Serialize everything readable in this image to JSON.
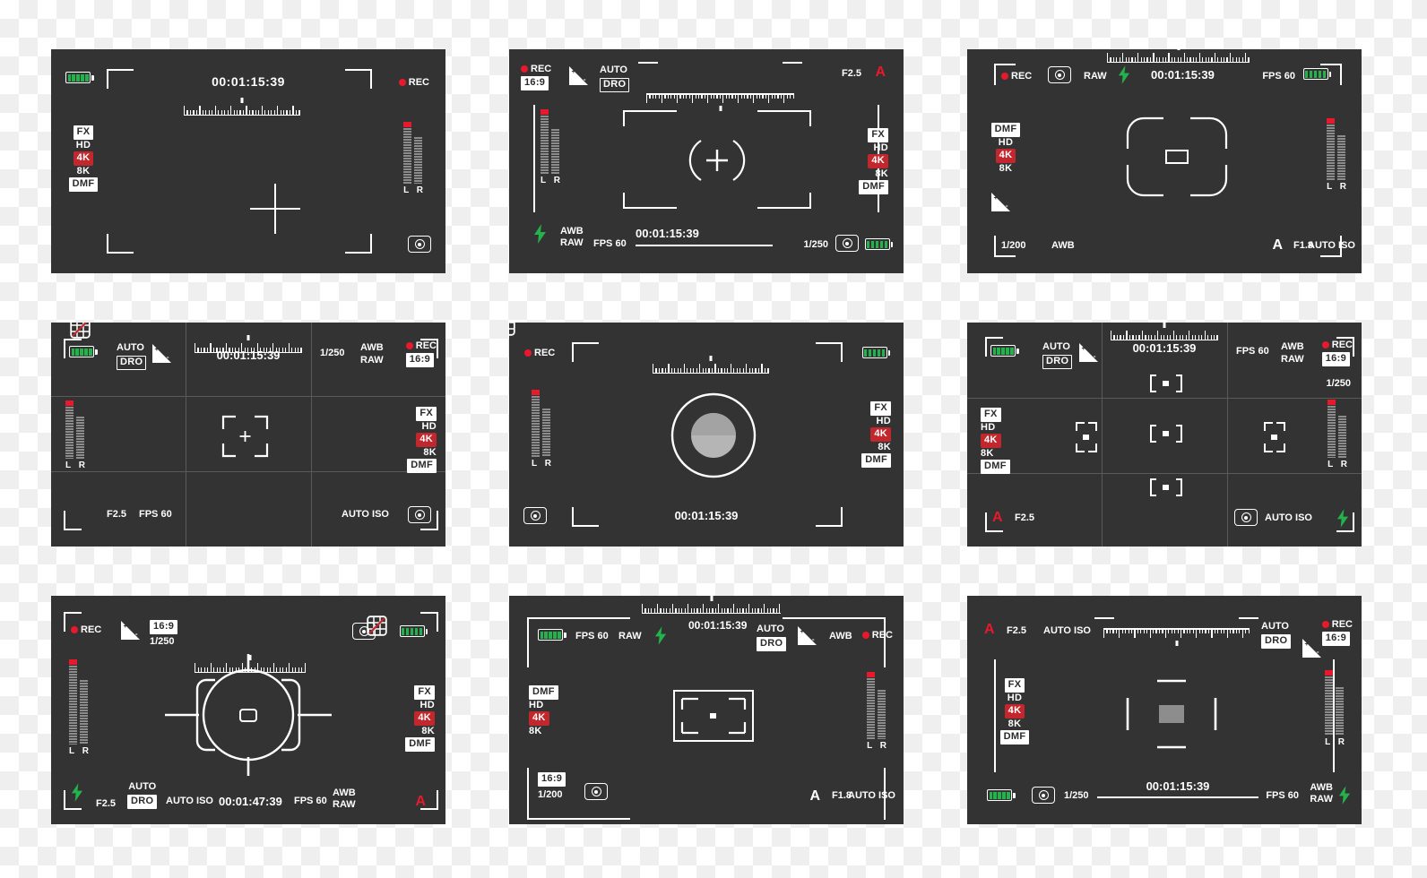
{
  "common": {
    "timecode": "00:01:15:39",
    "rec": "REC",
    "ratio_169": "16:9",
    "auto": "AUTO",
    "dro": "DRO",
    "raw": "RAW",
    "awb": "AWB",
    "fps60": "FPS 60",
    "fx": "FX",
    "hd": "HD",
    "k4": "4K",
    "k8": "8K",
    "dmf": "DMF",
    "auto_iso": "AUTO ISO",
    "audio_l": "L",
    "audio_r": "R",
    "audio_lr": "L R",
    "a_mode": "A",
    "f25": "F2.5",
    "f18": "F1.8",
    "ss_250": "1/250",
    "ss_200": "1/200"
  },
  "colors": {
    "panel_bg": "#333333",
    "rec_red": "#e8192c",
    "badge_red": "#c1272d",
    "battery_green": "#23b24b",
    "flash_green": "#23b24b",
    "white": "#ffffff",
    "divider": "#5a5a5a",
    "meter_gray": "#8c8c8c",
    "fill_gray": "#9a9a9a"
  },
  "panels": [
    {
      "id": "viewfinder-1",
      "layout": "crosshair-corners",
      "battery": "battery-icon",
      "timecode": "00:01:15:39",
      "rec": "REC",
      "resolutions": [
        "FX",
        "HD",
        "4K",
        "8K",
        "DMF"
      ],
      "selected_resolution": "4K",
      "grid_icon": "grid-off-icon",
      "metering_icon": "metering-icon",
      "audio_label": "L R"
    },
    {
      "id": "viewfinder-2",
      "layout": "center-bracket-plus",
      "rec": "REC",
      "ratio": "16:9",
      "ev_icon": "exposure-compensation-icon",
      "auto": "AUTO",
      "dro": "DRO",
      "aperture": "F2.5",
      "mode": "A",
      "flash_icon": "flash-icon",
      "awb": "AWB",
      "raw": "RAW",
      "fps": "FPS 60",
      "timecode": "00:01:15:39",
      "shutter": "1/250",
      "metering_icon": "metering-icon",
      "battery": "battery-icon",
      "resolutions": [
        "FX",
        "HD",
        "4K",
        "8K",
        "DMF"
      ],
      "selected_resolution": "4K",
      "audio_label": "L R"
    },
    {
      "id": "viewfinder-3",
      "layout": "rounded-focus-box",
      "rec": "REC",
      "metering_icon": "metering-icon",
      "raw": "RAW",
      "flash_icon": "flash-icon",
      "timecode": "00:01:15:39",
      "fps": "FPS 60",
      "battery": "battery-icon",
      "resolutions": [
        "DMF",
        "HD",
        "4K",
        "8K"
      ],
      "selected_resolution": "4K",
      "ev_icon": "exposure-compensation-icon",
      "shutter": "1/200",
      "awb": "AWB",
      "mode": "A",
      "aperture": "F1.8",
      "iso": "AUTO ISO",
      "audio_label": "L R"
    },
    {
      "id": "viewfinder-4",
      "layout": "thirds-grid",
      "battery": "battery-icon",
      "auto": "AUTO",
      "dro": "DRO",
      "ev_icon": "exposure-compensation-icon",
      "timecode": "00:01:15:39",
      "shutter": "1/250",
      "awb": "AWB",
      "raw": "RAW",
      "rec": "REC",
      "ratio": "16:9",
      "resolutions": [
        "FX",
        "HD",
        "4K",
        "8K",
        "DMF"
      ],
      "selected_resolution": "4K",
      "grid_icon": "grid-off-icon",
      "aperture": "F2.5",
      "fps": "FPS 60",
      "iso": "AUTO ISO",
      "metering_icon": "metering-icon",
      "audio_label": "L R"
    },
    {
      "id": "viewfinder-5",
      "layout": "circle-half-fill",
      "rec": "REC",
      "battery": "battery-icon",
      "timecode": "00:01:15:39",
      "metering_icon": "metering-icon",
      "grid_icon": "grid-off-icon",
      "resolutions": [
        "FX",
        "HD",
        "4K",
        "8K",
        "DMF"
      ],
      "selected_resolution": "4K",
      "audio_label": "L R"
    },
    {
      "id": "viewfinder-6",
      "layout": "thirds-grid-focus-points",
      "battery": "battery-icon",
      "auto": "AUTO",
      "dro": "DRO",
      "ev_icon": "exposure-compensation-icon",
      "timecode": "00:01:15:39",
      "fps": "FPS 60",
      "awb": "AWB",
      "raw": "RAW",
      "rec": "REC",
      "ratio": "16:9",
      "shutter": "1/250",
      "resolutions": [
        "FX",
        "HD",
        "4K",
        "8K",
        "DMF"
      ],
      "selected_resolution": "4K",
      "mode": "A",
      "aperture": "F2.5",
      "metering_icon": "metering-icon",
      "iso": "AUTO ISO",
      "flash_icon": "flash-icon",
      "audio_label": "L R"
    },
    {
      "id": "viewfinder-7",
      "layout": "circle-side-brackets",
      "rec": "REC",
      "ev_icon": "exposure-compensation-icon",
      "ratio": "16:9",
      "shutter": "1/250",
      "metering_icon": "metering-icon",
      "battery": "battery-icon",
      "resolutions": [
        "FX",
        "HD",
        "4K",
        "8K",
        "DMF"
      ],
      "selected_resolution": "4K",
      "flash_icon": "flash-icon",
      "aperture": "F2.5",
      "auto": "AUTO",
      "dro": "DRO",
      "iso": "AUTO ISO",
      "timecode": "00:01:47:39",
      "fps": "FPS 60",
      "awb": "AWB",
      "raw": "RAW",
      "grid_icon": "grid-off-icon",
      "mode": "A",
      "audio_label": "L R"
    },
    {
      "id": "viewfinder-8",
      "layout": "rect-focus-frame",
      "battery": "battery-icon",
      "fps": "FPS 60",
      "raw": "RAW",
      "flash_icon": "flash-icon",
      "timecode": "00:01:15:39",
      "auto": "AUTO",
      "dro": "DRO",
      "ev_icon": "exposure-compensation-icon",
      "awb": "AWB",
      "rec": "REC",
      "resolutions": [
        "DMF",
        "HD",
        "4K",
        "8K"
      ],
      "selected_resolution": "4K",
      "ratio": "16:9",
      "shutter": "1/200",
      "metering_icon": "metering-icon",
      "mode": "A",
      "aperture": "F1.8",
      "iso": "AUTO ISO",
      "audio_label": "L R"
    },
    {
      "id": "viewfinder-9",
      "layout": "segmented-frame-fill",
      "mode": "A",
      "aperture": "F2.5",
      "iso": "AUTO ISO",
      "auto": "AUTO",
      "dro": "DRO",
      "ev_icon": "exposure-compensation-icon",
      "rec": "REC",
      "ratio": "16:9",
      "resolutions": [
        "FX",
        "HD",
        "4K",
        "8K",
        "DMF"
      ],
      "selected_resolution": "4K",
      "battery": "battery-icon",
      "metering_icon": "metering-icon",
      "shutter": "1/250",
      "timecode": "00:01:15:39",
      "fps": "FPS 60",
      "awb": "AWB",
      "raw": "RAW",
      "flash_icon": "flash-icon",
      "audio_label": "L R"
    }
  ]
}
